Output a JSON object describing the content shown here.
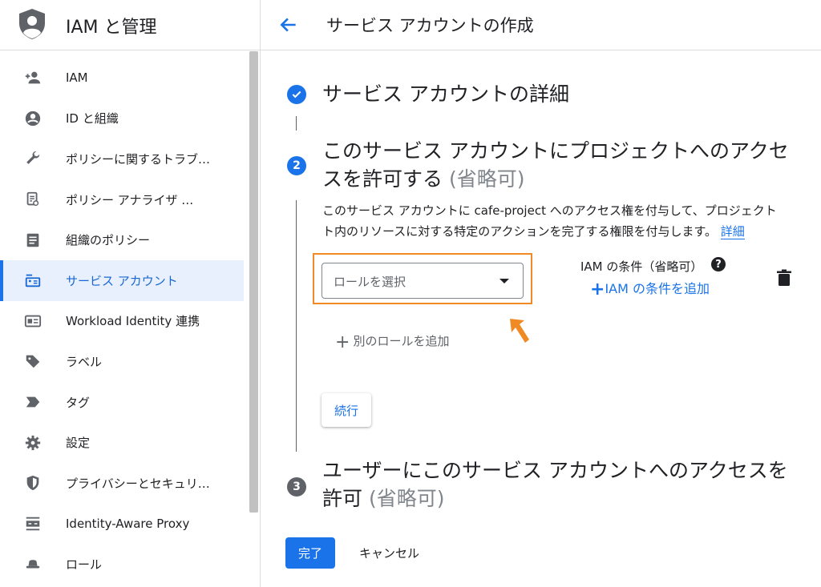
{
  "app": {
    "title": "IAM と管理"
  },
  "sidebar": {
    "items": [
      {
        "label": "IAM",
        "icon": "person-add-icon",
        "active": false
      },
      {
        "label": "ID と組織",
        "icon": "account-circle-icon",
        "active": false
      },
      {
        "label": "ポリシーに関するトラブ…",
        "icon": "wrench-icon",
        "active": false
      },
      {
        "label": "ポリシー アナライザ …",
        "icon": "policy-analyzer-icon",
        "active": false
      },
      {
        "label": "組織のポリシー",
        "icon": "document-list-icon",
        "active": false
      },
      {
        "label": "サービス アカウント",
        "icon": "service-account-icon",
        "active": true
      },
      {
        "label": "Workload Identity 連携",
        "icon": "id-card-icon",
        "active": false
      },
      {
        "label": "ラベル",
        "icon": "label-tag-icon",
        "active": false
      },
      {
        "label": "タグ",
        "icon": "tag-arrow-icon",
        "active": false
      },
      {
        "label": "設定",
        "icon": "gear-icon",
        "active": false
      },
      {
        "label": "プライバシーとセキュリ…",
        "icon": "shield-icon",
        "active": false
      },
      {
        "label": "Identity-Aware Proxy",
        "icon": "proxy-icon",
        "active": false
      },
      {
        "label": "ロール",
        "icon": "hat-icon",
        "active": false
      }
    ]
  },
  "header": {
    "title": "サービス アカウントの作成"
  },
  "steps": {
    "step1": {
      "title": "サービス アカウントの詳細"
    },
    "step2": {
      "number": "2",
      "title_line1": "このサービス アカウントにプロジェクトへのアクセ",
      "title_line2": "スを許可する",
      "optional": "(省略可)",
      "description_line1": "このサービス アカウントに cafe-project へのアクセス権を付与して、プロジェクト",
      "description_line2": "ト内のリソースに対する特定のアクションを完了する権限を付与します。",
      "details_link": "詳細",
      "role_placeholder": "ロールを選択",
      "condition_label": "IAM の条件（省略可）",
      "help_glyph": "?",
      "add_condition": "IAM の条件を追加",
      "add_condition_plus": "+",
      "add_role_plus": "+",
      "add_role": "別のロールを追加",
      "continue": "続行"
    },
    "step3": {
      "number": "3",
      "title_line1": "ユーザーにこのサービス アカウントへのアクセスを",
      "title_line2": "許可",
      "optional": "(省略可)"
    }
  },
  "footer": {
    "done": "完了",
    "cancel": "キャンセル"
  },
  "colors": {
    "accent": "#1a73e8",
    "highlight": "#f08a24",
    "active_bg": "#e8f0fe",
    "step_gray": "#5f6368"
  }
}
